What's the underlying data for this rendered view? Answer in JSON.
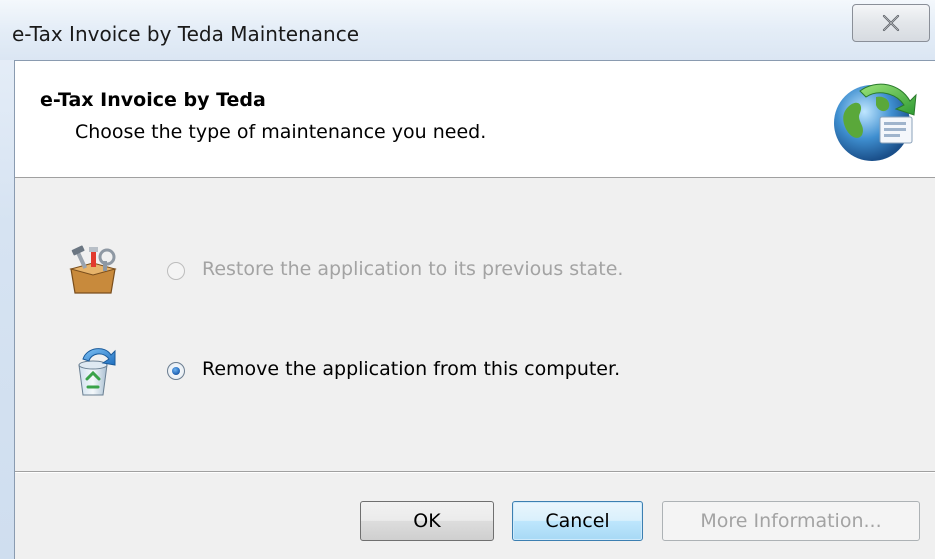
{
  "window": {
    "title": "e-Tax Invoice by Teda Maintenance",
    "close_icon": "close-icon"
  },
  "header": {
    "title": "e-Tax Invoice by Teda",
    "subtitle": "Choose the type of maintenance you need.",
    "icon": "globe-setup-icon"
  },
  "options": [
    {
      "label": "Restore the application to its previous state.",
      "icon": "toolbox-icon",
      "selected": false,
      "enabled": false
    },
    {
      "label": "Remove the application from this computer.",
      "icon": "recycle-bin-icon",
      "selected": true,
      "enabled": true
    }
  ],
  "buttons": {
    "ok_label": "OK",
    "cancel_label": "Cancel",
    "more_info_label": "More Information..."
  },
  "colors": {
    "disabled_text": "#a3a3a3",
    "focus_border": "#3c7fb1"
  }
}
